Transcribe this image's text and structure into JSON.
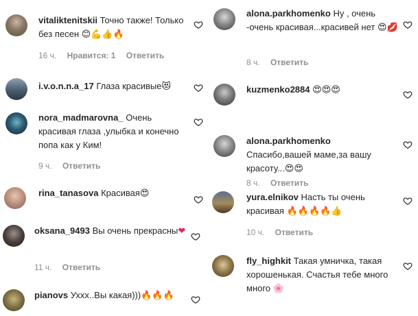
{
  "left": [
    {
      "user": "vitaliktenitskii",
      "text": "Точно также! Только без песен",
      "emoji": "😊💪👍🔥",
      "time": "16 ч.",
      "likes": "Нравится: 1",
      "reply": "Ответить"
    },
    {
      "user": "i.v.o.n.n.a_17",
      "text": "Глаза красивые",
      "emoji": "😻",
      "time": "",
      "likes": "",
      "reply": ""
    },
    {
      "user": "nora_madmarovna_",
      "text": "Очень красивая глаза ,улыбка и конечно попа как у Ким!",
      "emoji": "",
      "time": "9 ч.",
      "likes": "",
      "reply": "Ответить"
    },
    {
      "user": "rina_tanasova",
      "text": "Красивая",
      "emoji": "😍",
      "time": "",
      "likes": "",
      "reply": ""
    },
    {
      "user": "oksana_9493",
      "text": "Вы очень прекрасны",
      "emoji": "❤",
      "time": "11 ч.",
      "likes": "",
      "reply": "Ответить"
    },
    {
      "user": "pianovs",
      "text": "Уххх..Вы какая)))",
      "emoji": "🔥🔥🔥",
      "time": "",
      "likes": "",
      "reply": ""
    }
  ],
  "right": [
    {
      "user": "alona.parkhomenko",
      "text": "Ну , очень -очень красивая...красивей нет",
      "emoji": "😍💋",
      "time": "8 ч.",
      "likes": "",
      "reply": "Ответить"
    },
    {
      "user": "kuzmenko2884",
      "text": "",
      "emoji": "😍😍😍",
      "time": "",
      "likes": "",
      "reply": ""
    },
    {
      "user": "alona.parkhomenko",
      "text": "Спасибо,вашей маме,за вашу красоту...",
      "emoji": "😍😍",
      "time": "8 ч.",
      "likes": "",
      "reply": "Ответить"
    },
    {
      "user": "yura.elnikov",
      "text": "Насть ты очень красивая",
      "emoji": "🔥🔥🔥🔥👍",
      "time": "10 ч.",
      "likes": "",
      "reply": "Ответить"
    },
    {
      "user": "fly_highkit",
      "text": "Такая умничка, такая хорошенькая. Счастья тебе много много",
      "emoji": "🌸",
      "time": "",
      "likes": "",
      "reply": ""
    }
  ],
  "colors": {
    "text": "#262626",
    "meta": "#8e8e8e",
    "heart_outline": "#262626"
  }
}
